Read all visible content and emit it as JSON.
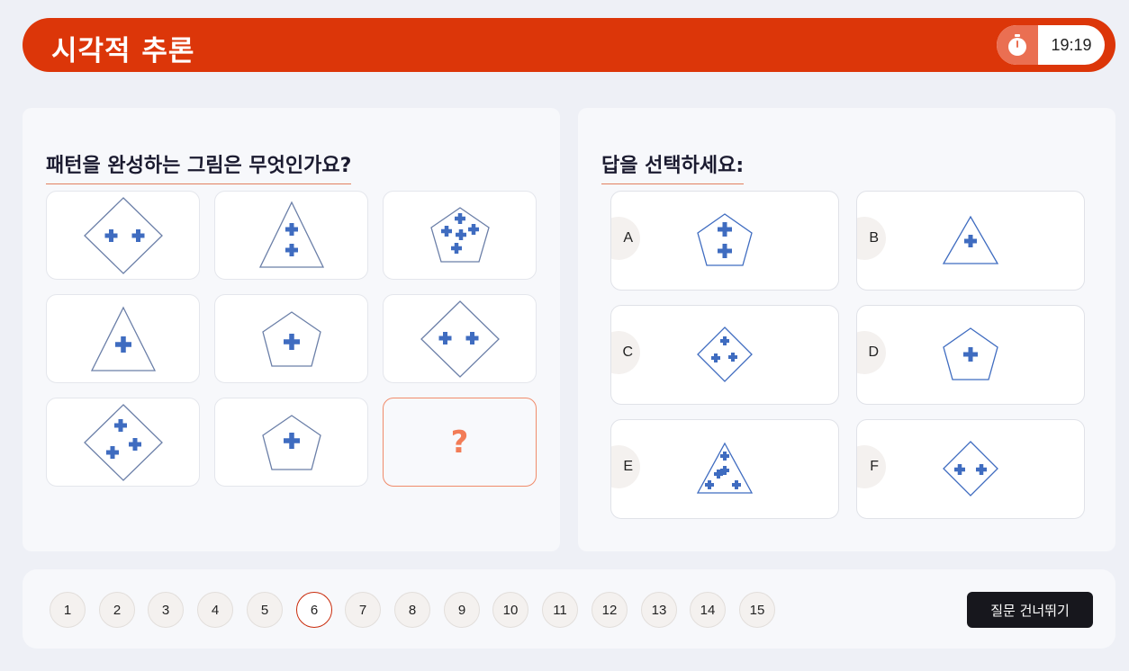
{
  "header": {
    "title": "시각적 추론",
    "timer": "19:19",
    "timer_icon": "stopwatch-icon"
  },
  "question": {
    "prompt": "패턴을 완성하는 그림은 무엇인가요?",
    "grid": [
      {
        "shape": "diamond",
        "plus": 2
      },
      {
        "shape": "triangle",
        "plus": 2
      },
      {
        "shape": "pentagon",
        "plus": 5
      },
      {
        "shape": "triangle",
        "plus": 1
      },
      {
        "shape": "pentagon",
        "plus": 1
      },
      {
        "shape": "diamond",
        "plus": 2
      },
      {
        "shape": "diamond",
        "plus": 3
      },
      {
        "shape": "pentagon",
        "plus": 1
      },
      {
        "shape": "missing",
        "label": "?"
      }
    ]
  },
  "answers": {
    "heading": "답을 선택하세요:",
    "options": [
      {
        "letter": "A",
        "shape": "pentagon",
        "plus": 2
      },
      {
        "letter": "B",
        "shape": "triangle",
        "plus": 1
      },
      {
        "letter": "C",
        "shape": "diamond",
        "plus": 3
      },
      {
        "letter": "D",
        "shape": "pentagon",
        "plus": 1
      },
      {
        "letter": "E",
        "shape": "triangle",
        "plus": 5
      },
      {
        "letter": "F",
        "shape": "diamond",
        "plus": 2
      }
    ]
  },
  "navigation": {
    "pages": [
      "1",
      "2",
      "3",
      "4",
      "5",
      "6",
      "7",
      "8",
      "9",
      "10",
      "11",
      "12",
      "13",
      "14",
      "15"
    ],
    "current": "6",
    "skip_label": "질문 건너뛰기"
  },
  "colors": {
    "accent": "#dc3609",
    "shape_stroke": "#6b7fa8",
    "plus_fill": "#3f6cc0",
    "question_mark": "#f27c57"
  }
}
